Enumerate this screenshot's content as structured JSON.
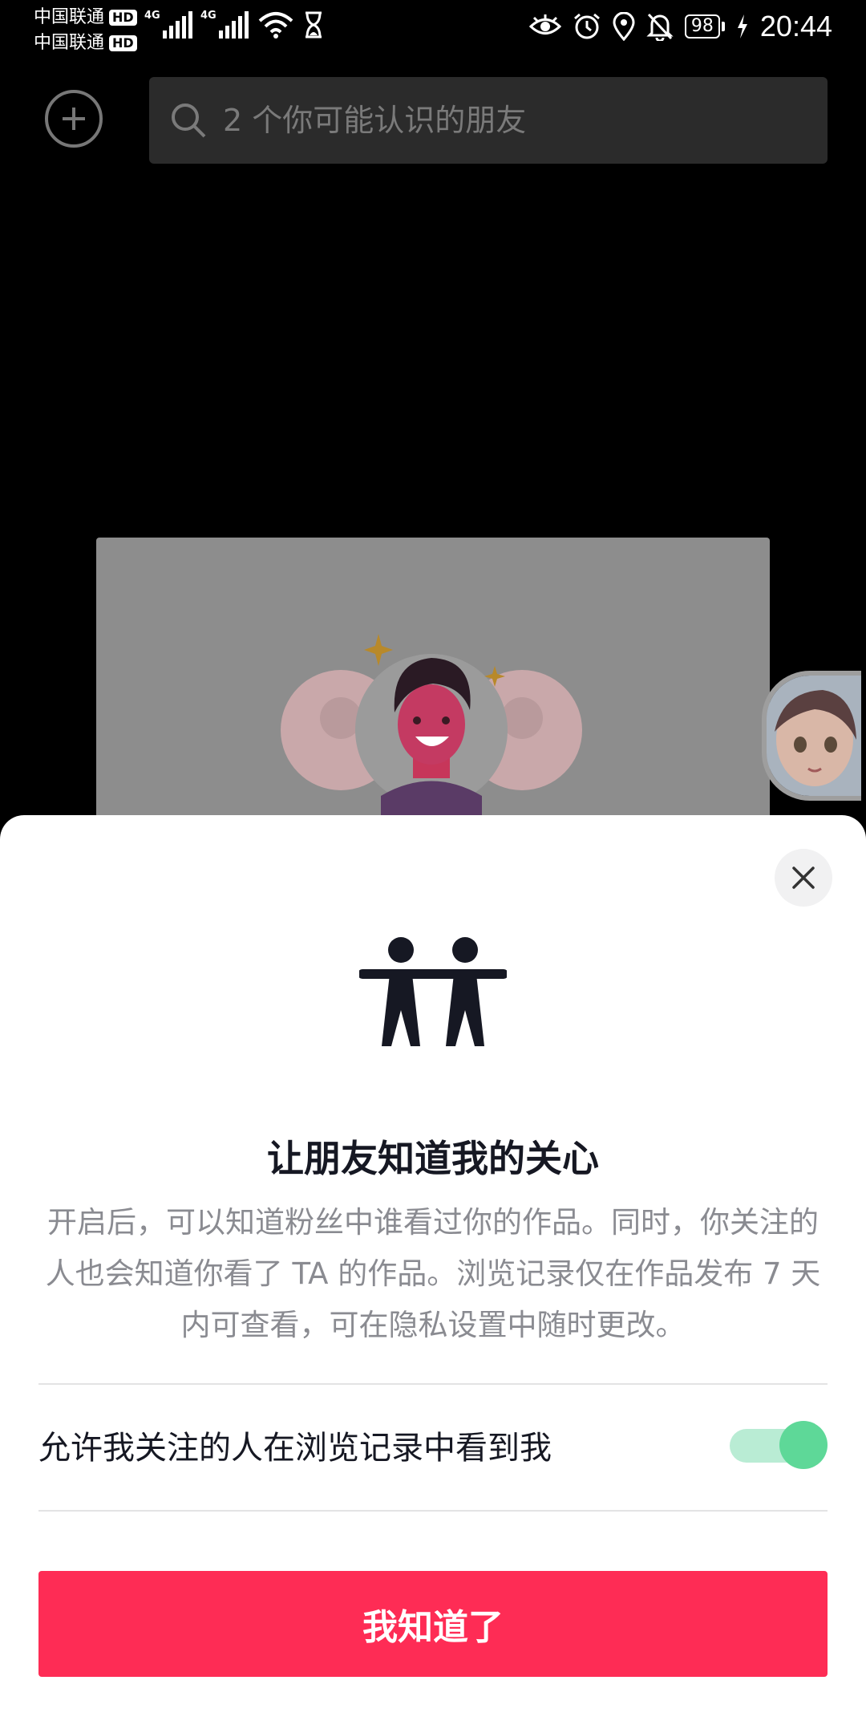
{
  "status_bar": {
    "carrier_1": "中国联通",
    "carrier_2": "中国联通",
    "hd_badge": "HD",
    "network_1": "4G",
    "network_2": "4G",
    "battery_level": "98",
    "time": "20:44"
  },
  "search": {
    "placeholder": "2 个你可能认识的朋友"
  },
  "sheet": {
    "title": "让朋友知道我的关心",
    "description": "开启后，可以知道粉丝中谁看过你的作品。同时，你关注的人也会知道你看了 TA 的作品。浏览记录仅在作品发布 7 天内可查看，可在隐私设置中随时更改。",
    "toggle_label": "允许我关注的人在浏览记录中看到我",
    "toggle_on": true,
    "confirm_label": "我知道了"
  },
  "colors": {
    "accent": "#fe2c55",
    "toggle_on": "#5ed898",
    "text_primary": "#161823",
    "text_secondary": "#8a8b91"
  }
}
